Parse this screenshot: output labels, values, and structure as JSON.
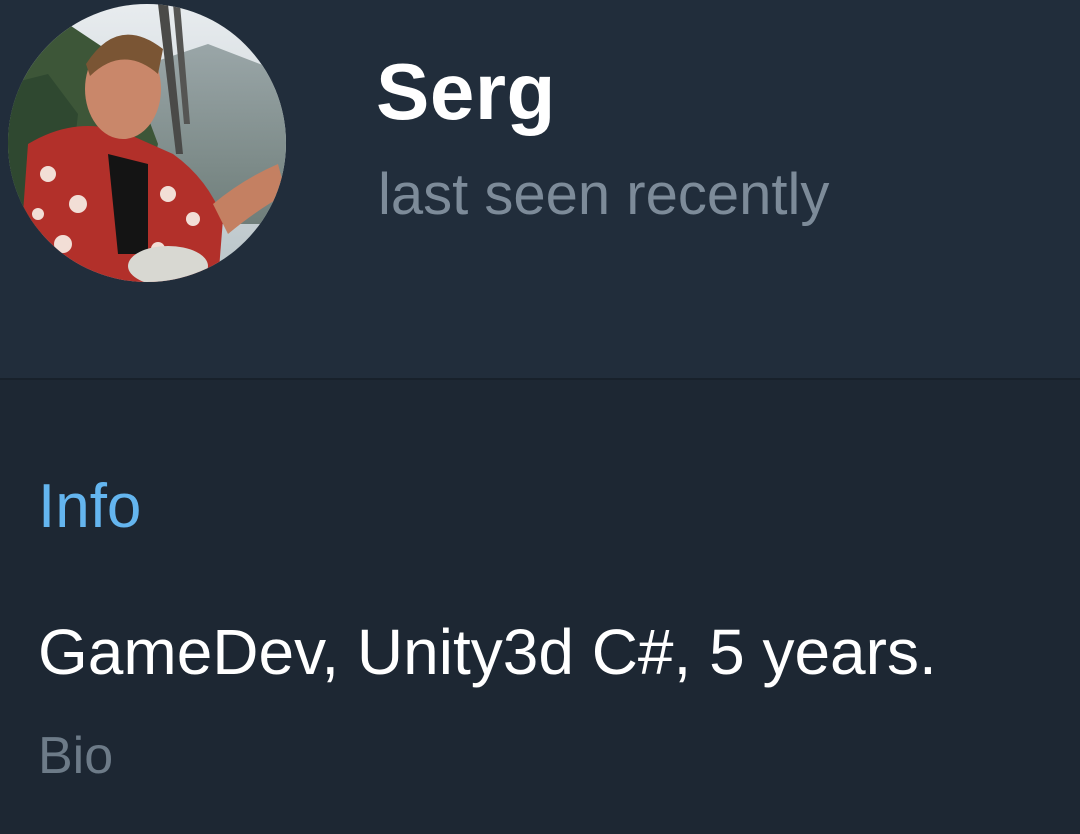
{
  "profile": {
    "name": "Serg",
    "status": "last seen recently"
  },
  "info": {
    "section_title": "Info",
    "bio_value": "GameDev, Unity3d C#, 5 years.",
    "bio_label": "Bio"
  },
  "colors": {
    "header_bg": "#212d3b",
    "body_bg": "#1d2733",
    "accent": "#64b5ef",
    "secondary_text": "#7d8b99"
  }
}
